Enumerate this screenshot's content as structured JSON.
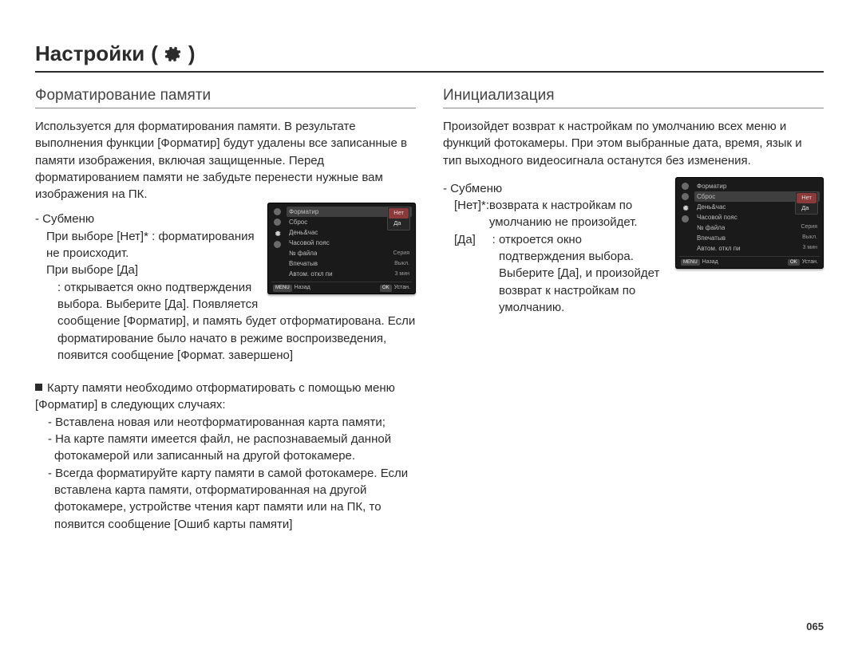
{
  "page_number": "065",
  "title": "Настройки",
  "title_parens": {
    "open": "(",
    "close": ")"
  },
  "sections": {
    "left": {
      "heading": "Форматирование памяти",
      "intro": "Используется для форматирования памяти. В результате выполнения функции [Форматир] будут удалены все записанные в памяти изображения, включая защищенные. Перед форматированием памяти не забудьте перенести нужные вам изображения на ПК.",
      "submenu_label": "- Субменю",
      "opt_no_key": "При выборе [Нет]*",
      "opt_no_sep": " : ",
      "opt_no_val": "форматирования не происходит.",
      "opt_yes_key": "При выборе [Да]",
      "opt_yes_body": ": открывается окно подтверждения выбора. Выберите [Да]. Появляется сообщение [Форматир], и память будет отформатирована. Если форматирование было начато в режиме воспроизведения, появится сообщение [Формат. завершено]",
      "bullet_lead": "Карту памяти необходимо отформатировать с помощью меню [Форматир] в следующих случаях:",
      "bullets": [
        "- Вставлена новая или неотформатированная карта памяти;",
        "- На карте памяти имеется файл, не распознаваемый данной фотокамерой или записанный на другой фотокамере.",
        "- Всегда форматируйте карту памяти в самой фотокамере. Если вставлена карта памяти, отформатированная на другой фотокамере, устройстве чтения карт памяти или на ПК, то появится сообщение [Ошиб карты памяти]"
      ]
    },
    "right": {
      "heading": "Инициализация",
      "intro": "Произойдет возврат к настройкам по умолчанию всех меню и функций фотокамеры. При этом выбранные дата, время, язык и тип выходного видеосигнала останутся без изменения.",
      "submenu_label": "- Субменю",
      "opt_no_key": "[Нет]*",
      "opt_no_sep": " : ",
      "opt_no_val": "возврата к настройкам по умолчанию не произойдет.",
      "opt_yes_key": "[Да]",
      "opt_yes_sep": "     : ",
      "opt_yes_val": "откроется окно подтверждения выбора. Выберите [Да], и произойдет возврат к настройкам по умолчанию."
    }
  },
  "lcd_a": {
    "rows": [
      {
        "l": "Форматир",
        "r": ""
      },
      {
        "l": "Сброс",
        "r": ""
      },
      {
        "l": "День&час",
        "r": ""
      },
      {
        "l": "Часовой пояс",
        "r": ""
      },
      {
        "l": "№ файла",
        "r": "Серия"
      },
      {
        "l": "Впечатыв",
        "r": "Выкл."
      },
      {
        "l": "Автом. откл пи",
        "r": "3 мин"
      }
    ],
    "popup": {
      "options": [
        "Нет",
        "Да"
      ],
      "hl_index": 0,
      "anchor_row": 0
    },
    "foot_left_key": "MENU",
    "foot_left_txt": "Назад",
    "foot_right_key": "OK",
    "foot_right_txt": "Устан."
  },
  "lcd_b": {
    "rows": [
      {
        "l": "Форматир",
        "r": ""
      },
      {
        "l": "Сброс",
        "r": ""
      },
      {
        "l": "День&час",
        "r": ""
      },
      {
        "l": "Часовой пояс",
        "r": ""
      },
      {
        "l": "№ файла",
        "r": "Серия"
      },
      {
        "l": "Впечатыв",
        "r": "Выкл."
      },
      {
        "l": "Автом. откл пи",
        "r": "3 мин"
      }
    ],
    "popup": {
      "options": [
        "Нет",
        "Да"
      ],
      "hl_index": 0,
      "anchor_row": 1
    },
    "foot_left_key": "MENU",
    "foot_left_txt": "Назад",
    "foot_right_key": "OK",
    "foot_right_txt": "Устан."
  }
}
